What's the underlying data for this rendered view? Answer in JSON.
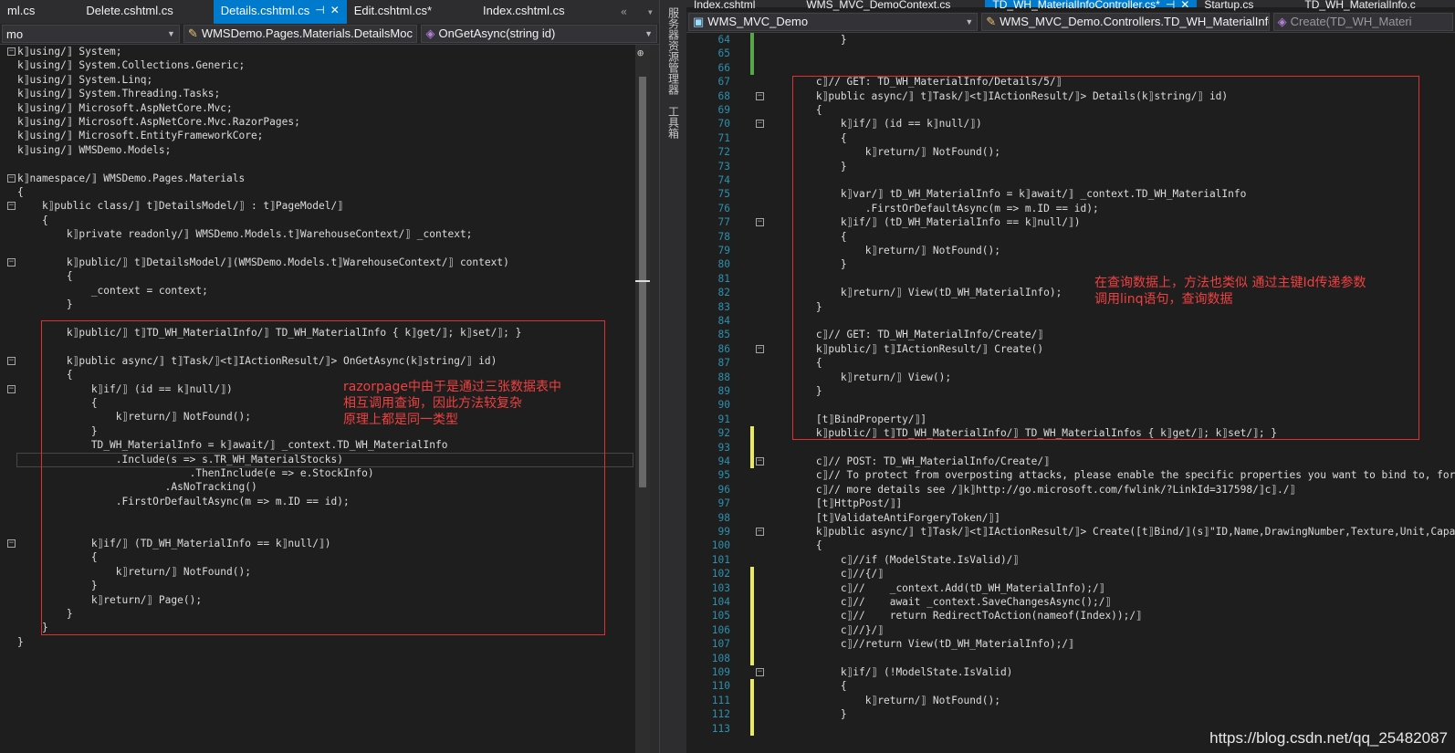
{
  "left": {
    "tabs": [
      "ml.cs",
      "Delete.cshtml.cs",
      "Details.cshtml.cs",
      "Edit.cshtml.cs*",
      "Index.cshtml.cs"
    ],
    "active_tab": "Details.cshtml.cs",
    "nav": {
      "project": "mo",
      "class": "WMSDemo.Pages.Materials.DetailsMoc",
      "member": "OnGetAsync(string id)"
    },
    "annotation": "razorpage中由于是通过三张数据表中\n相互调用查询，因此方法较复杂\n原理上都是同一类型"
  },
  "sidebar_tabs": [
    "服务器资源管理器",
    "工具箱"
  ],
  "right": {
    "tabs": [
      "Index.cshtml",
      "WMS_MVC_DemoContext.cs",
      "TD_WH_MaterialInfoController.cs*",
      "Startup.cs",
      "TD_WH_MaterialInfo.c"
    ],
    "active_tab": "TD_WH_MaterialInfoController.cs*",
    "nav": {
      "project": "WMS_MVC_Demo",
      "class": "WMS_MVC_Demo.Controllers.TD_WH_MaterialInfoC",
      "member": "Create(TD_WH_Materi"
    },
    "annotation": "在查询数据上，方法也类似 通过主键Id传递参数\n调用linq语句，查询数据",
    "line_numbers": [
      "64",
      "65",
      "66",
      "67",
      "68",
      "69",
      "70",
      "71",
      "72",
      "73",
      "74",
      "75",
      "76",
      "77",
      "78",
      "79",
      "80",
      "81",
      "82",
      "83",
      "84",
      "85",
      "86",
      "87",
      "88",
      "89",
      "90",
      "91",
      "92",
      "93",
      "94",
      "95",
      "96",
      "97",
      "98",
      "99",
      "100",
      "101",
      "102",
      "103",
      "104",
      "105",
      "106",
      "107",
      "108",
      "109",
      "110",
      "111",
      "112",
      "113"
    ]
  },
  "watermark": "https://blog.csdn.net/qq_25482087"
}
